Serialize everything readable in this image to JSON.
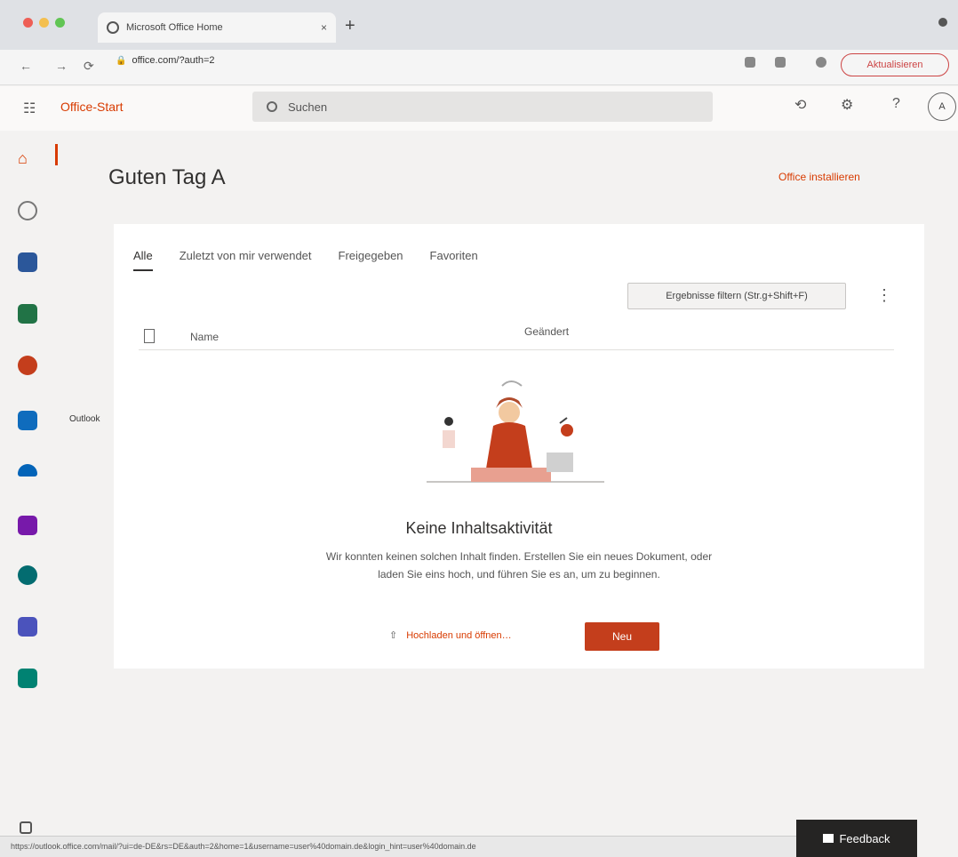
{
  "browser": {
    "tab_title": "Microsoft Office Home",
    "tab_close": "×",
    "new_tab": "+",
    "nav_back": "←",
    "nav_forward": "→",
    "nav_reload": "⟳",
    "url": "office.com/?auth=2",
    "update_label": "Aktualisieren"
  },
  "appbar": {
    "brand": "Office-Start",
    "search_placeholder": "Suchen",
    "waffle": "☷",
    "icons": [
      "refresh-icon",
      "settings-icon",
      "help-icon"
    ],
    "avatar_initials": "A"
  },
  "rail": {
    "label": "Outlook",
    "items": [
      "home-icon",
      "create-icon",
      "word-icon",
      "excel-icon",
      "powerpoint-icon",
      "outlook-icon",
      "onedrive-icon",
      "onenote-icon",
      "sharepoint-icon",
      "teams-icon",
      "sway-icon"
    ]
  },
  "main": {
    "greeting": "Guten Tag A",
    "install_link": "Office installieren",
    "tabs": [
      "Alle",
      "Zuletzt von mir verwendet",
      "Freigegeben",
      "Favoriten"
    ],
    "filter_label": "Ergebnisse filtern (Str.g+Shift+F)",
    "more": "⋮",
    "list_headers": {
      "name": "Name",
      "modified": "Geändert"
    },
    "empty_title": "Keine Inhaltsaktivität",
    "empty_text": "Wir konnten keinen solchen Inhalt finden. Erstellen Sie ein neues Dokument, oder laden Sie eins hoch, und führen Sie es an, um zu beginnen.",
    "upload_label": "Hochladen und öffnen…",
    "new_label": "Neu"
  },
  "footer": {
    "status_text": "https://outlook.office.com/mail/?ui=de-DE&rs=DE&auth=2&home=1&username=user%40domain.de&login_hint=user%40domain.de",
    "feedback_label": "Feedback"
  },
  "colors": {
    "accent": "#d83b01",
    "primary_button": "#c43e1c"
  }
}
